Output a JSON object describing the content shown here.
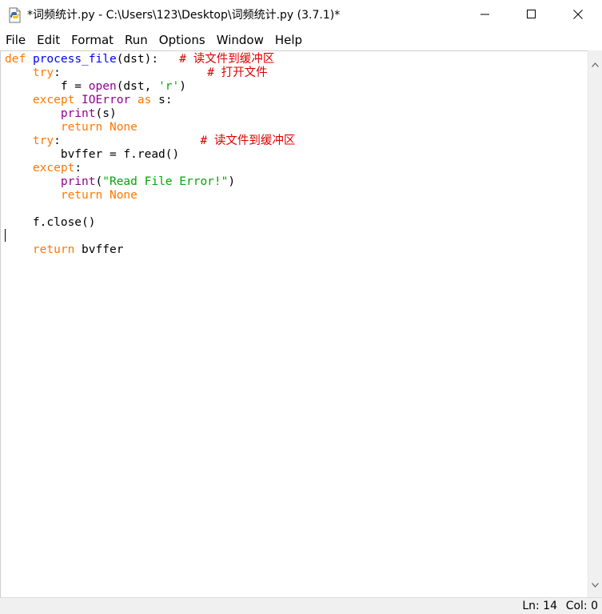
{
  "window": {
    "title": "*词频统计.py - C:\\Users\\123\\Desktop\\词频统计.py (3.7.1)*"
  },
  "menu": {
    "items": [
      "File",
      "Edit",
      "Format",
      "Run",
      "Options",
      "Window",
      "Help"
    ]
  },
  "editor": {
    "lines": [
      [
        {
          "t": "def",
          "c": "kw"
        },
        {
          "t": " "
        },
        {
          "t": "process_file",
          "c": "def"
        },
        {
          "t": "(dst):   "
        },
        {
          "t": "# 读文件到缓冲区",
          "c": "cm"
        }
      ],
      [
        {
          "t": "    "
        },
        {
          "t": "try",
          "c": "kw"
        },
        {
          "t": ":                     "
        },
        {
          "t": "# 打开文件",
          "c": "cm"
        }
      ],
      [
        {
          "t": "        f = "
        },
        {
          "t": "open",
          "c": "bi"
        },
        {
          "t": "(dst, "
        },
        {
          "t": "'r'",
          "c": "str"
        },
        {
          "t": ")"
        }
      ],
      [
        {
          "t": "    "
        },
        {
          "t": "except",
          "c": "kw"
        },
        {
          "t": " "
        },
        {
          "t": "IOError",
          "c": "bi"
        },
        {
          "t": " "
        },
        {
          "t": "as",
          "c": "kw"
        },
        {
          "t": " s:"
        }
      ],
      [
        {
          "t": "        "
        },
        {
          "t": "print",
          "c": "bi"
        },
        {
          "t": "(s)"
        }
      ],
      [
        {
          "t": "        "
        },
        {
          "t": "return",
          "c": "kw"
        },
        {
          "t": " "
        },
        {
          "t": "None",
          "c": "kw"
        }
      ],
      [
        {
          "t": "    "
        },
        {
          "t": "try",
          "c": "kw"
        },
        {
          "t": ":                    "
        },
        {
          "t": "# 读文件到缓冲区",
          "c": "cm"
        }
      ],
      [
        {
          "t": "        bvffer = f.read()"
        }
      ],
      [
        {
          "t": "    "
        },
        {
          "t": "except",
          "c": "kw"
        },
        {
          "t": ":"
        }
      ],
      [
        {
          "t": "        "
        },
        {
          "t": "print",
          "c": "bi"
        },
        {
          "t": "("
        },
        {
          "t": "\"Read File Error!\"",
          "c": "str"
        },
        {
          "t": ")"
        }
      ],
      [
        {
          "t": "        "
        },
        {
          "t": "return",
          "c": "kw"
        },
        {
          "t": " "
        },
        {
          "t": "None",
          "c": "kw"
        }
      ],
      [
        {
          "t": ""
        }
      ],
      [
        {
          "t": "    f.close()"
        }
      ],
      [
        {
          "t": ""
        }
      ],
      [
        {
          "t": "    "
        },
        {
          "t": "return",
          "c": "kw"
        },
        {
          "t": " bvffer"
        }
      ]
    ]
  },
  "status": {
    "ln": "Ln: 14",
    "col": "Col: 0"
  },
  "colors": {
    "keyword": "#ff7700",
    "definition": "#0000ff",
    "builtin": "#900090",
    "string": "#00aa00",
    "comment": "#dd0000"
  },
  "icons": {
    "app": "python-file-icon",
    "minimize": "minimize-icon",
    "maximize": "maximize-icon",
    "close": "close-icon"
  }
}
